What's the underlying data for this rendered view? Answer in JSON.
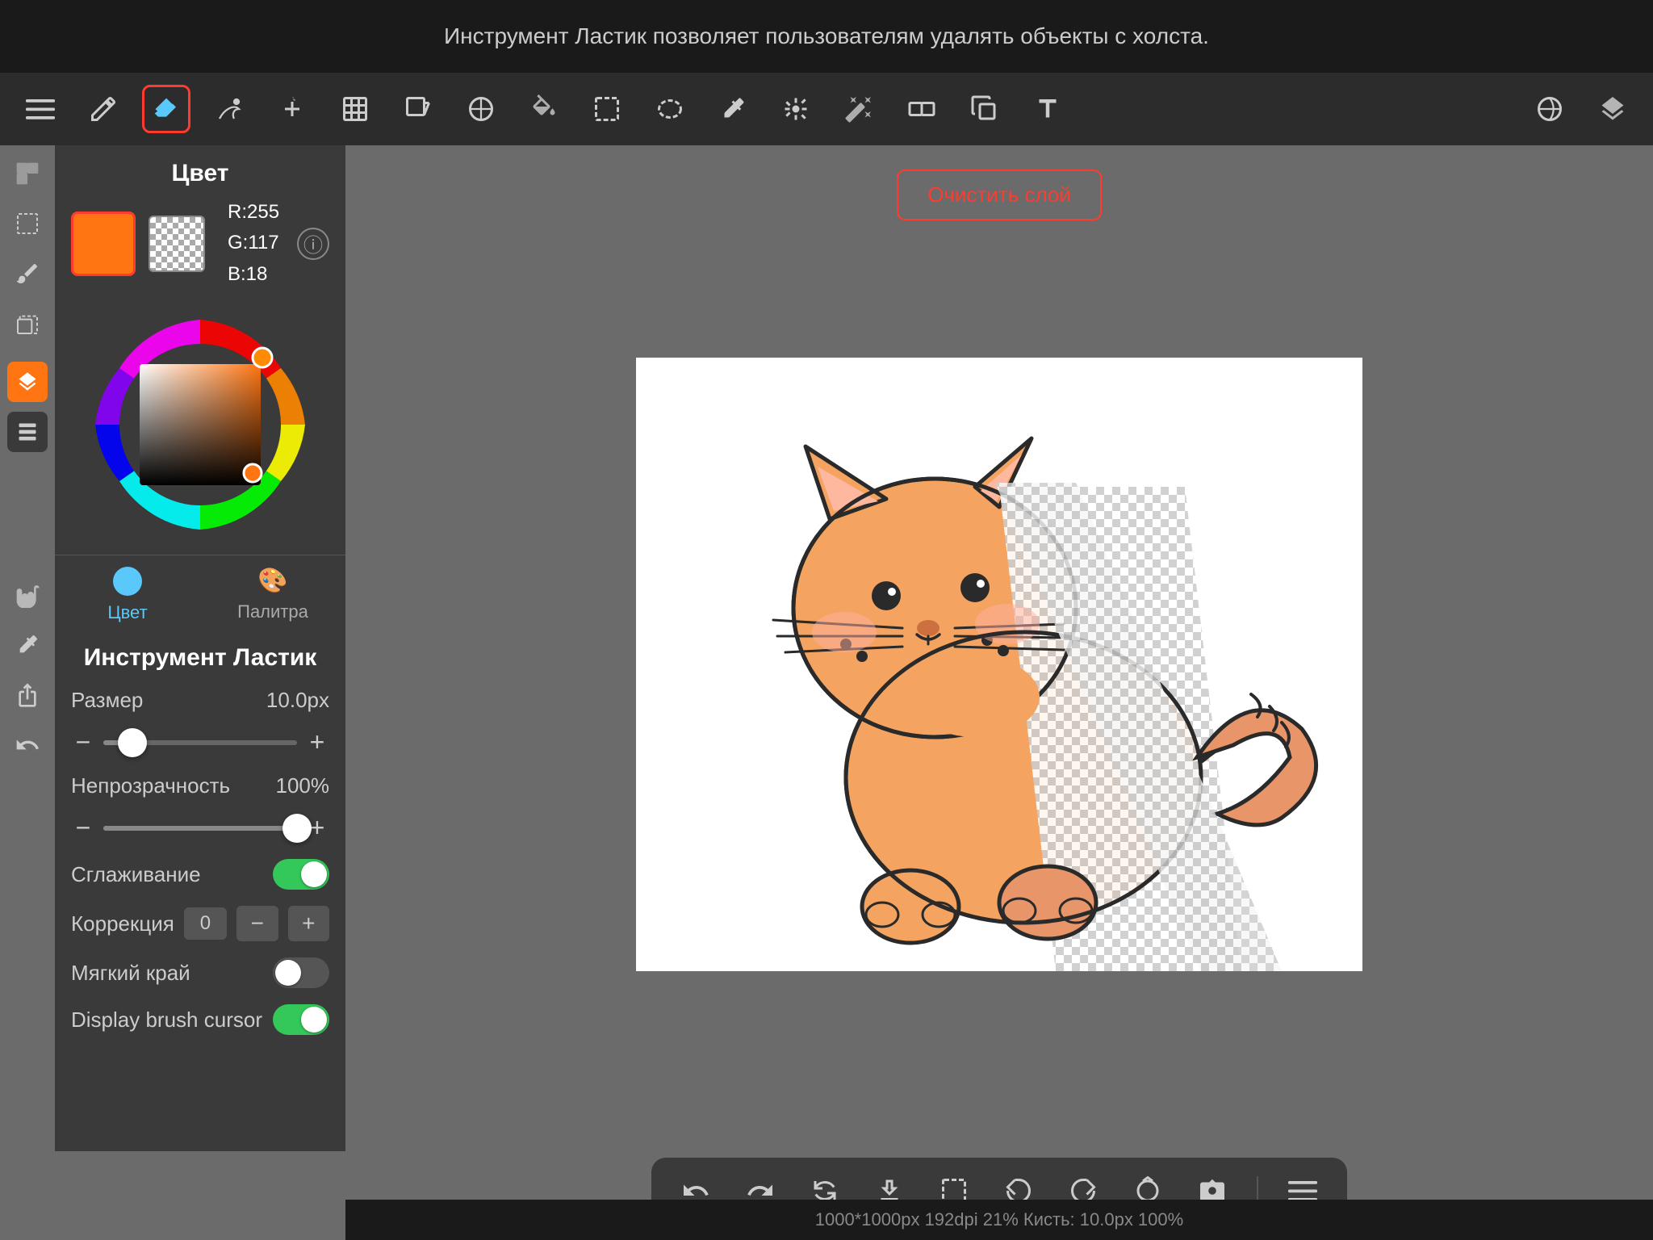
{
  "topBar": {
    "title": "Инструмент Ластик позволяет пользователям удалять объекты с холста."
  },
  "toolbar": {
    "tools": [
      {
        "name": "menu",
        "label": "☰"
      },
      {
        "name": "pencil",
        "label": "✏"
      },
      {
        "name": "eraser",
        "label": "◆"
      },
      {
        "name": "smudge",
        "label": "✦"
      },
      {
        "name": "move",
        "label": "✛"
      },
      {
        "name": "transform",
        "label": "⊞"
      },
      {
        "name": "transform2",
        "label": "⊟"
      },
      {
        "name": "fill",
        "label": "⊕"
      },
      {
        "name": "bucket",
        "label": "◎"
      },
      {
        "name": "rect",
        "label": "▭"
      },
      {
        "name": "select",
        "label": "⬚"
      },
      {
        "name": "eyedropper2",
        "label": "💧"
      },
      {
        "name": "adjustments",
        "label": "🎛"
      },
      {
        "name": "magic",
        "label": "◇"
      },
      {
        "name": "arrange",
        "label": "⊞"
      },
      {
        "name": "lasso",
        "label": "ω"
      },
      {
        "name": "text",
        "label": "T"
      },
      {
        "name": "layers",
        "label": "⊕"
      },
      {
        "name": "stack",
        "label": "⧉"
      }
    ],
    "clearLayerBtn": "Очистить слой"
  },
  "colorPanel": {
    "title": "Цвет",
    "rgb": {
      "r": "R:255",
      "g": "G:117",
      "b": "B:18"
    },
    "tabs": [
      {
        "id": "color",
        "label": "Цвет",
        "active": true
      },
      {
        "id": "palette",
        "label": "Палитра",
        "active": false
      }
    ]
  },
  "toolSettings": {
    "title": "Инструмент Ластик",
    "size": {
      "label": "Размер",
      "value": "10.0px",
      "percent": 15
    },
    "opacity": {
      "label": "Непрозрачность",
      "value": "100%",
      "percent": 100
    },
    "smoothing": {
      "label": "Сглаживание",
      "enabled": true
    },
    "correction": {
      "label": "Коррекция",
      "value": "0"
    },
    "softEdge": {
      "label": "Мягкий край",
      "enabled": false
    },
    "displayBrushCursor": {
      "label": "Display brush cursor",
      "enabled": true
    }
  },
  "statusBar": {
    "text": "1000*1000px 192dpi 21% Кисть: 10.0px 100%"
  },
  "bottomBar": {
    "buttons": [
      "↩",
      "↪",
      "↺",
      "⬇",
      "⬚",
      "↶",
      "↷",
      "◷",
      "📷",
      "≡"
    ]
  }
}
